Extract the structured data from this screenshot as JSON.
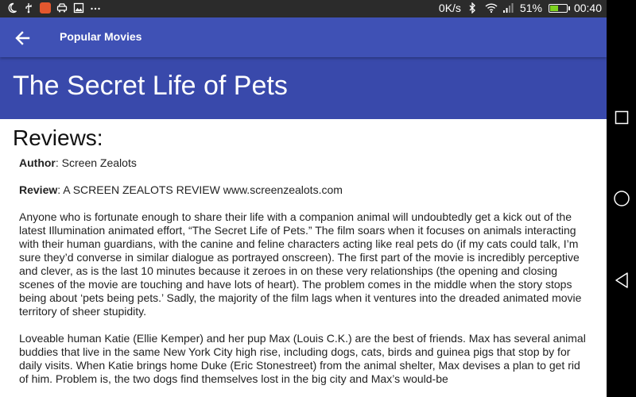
{
  "status_bar": {
    "network_speed": "0K/s",
    "battery_percent": "51%",
    "battery_level": 0.51,
    "time": "00:40",
    "left_icons": [
      "moon-icon",
      "usb-icon",
      "app-notification-icon",
      "car-icon",
      "image-icon",
      "more-dots-icon"
    ],
    "right_icons": [
      "bluetooth-icon",
      "wifi-icon",
      "signal-icon",
      "battery-icon"
    ]
  },
  "toolbar": {
    "back_icon": "arrow-back-icon",
    "title": "Popular Movies",
    "color": "#3f51b5"
  },
  "movie": {
    "title": "The Secret Life of Pets",
    "header_color": "#3949ab"
  },
  "reviews": {
    "heading": "Reviews:",
    "author_label": "Author",
    "author": ": Screen Zealots",
    "review_label": "Review",
    "review_intro": ": A SCREEN ZEALOTS REVIEW www.screenzealots.com",
    "paragraph_1": "Anyone who is fortunate enough to share their life with a companion animal will undoubtedly get a kick out of the latest Illumination animated effort, “The Secret Life of Pets.” The film soars when it focuses on animals interacting with their human guardians, with the canine and feline characters acting like real pets do (if my cats could talk, I’m sure they’d converse in similar dialogue as portrayed onscreen). The first part of the movie is incredibly perceptive and clever, as is the last 10 minutes because it zeroes in on these very relationships (the opening and closing scenes of the movie are touching and have lots of heart). The problem comes in the middle when the story stops being about ‘pets being pets.’ Sadly, the majority of the film lags when it ventures into the dreaded animated movie territory of sheer stupidity.",
    "paragraph_2": "Loveable human Katie (Ellie Kemper) and her pup Max (Louis C.K.) are the best of friends. Max has several animal buddies that live in the same New York City high rise, including dogs, cats, birds and guinea pigs that stop by for daily visits. When Katie brings home Duke (Eric Stonestreet) from the animal shelter, Max devises a plan to get rid of him. Problem is, the two dogs find themselves lost in the big city and Max’s would-be"
  },
  "navigation_bar": {
    "buttons": [
      "recents-square-icon",
      "home-circle-icon",
      "back-triangle-icon"
    ]
  }
}
